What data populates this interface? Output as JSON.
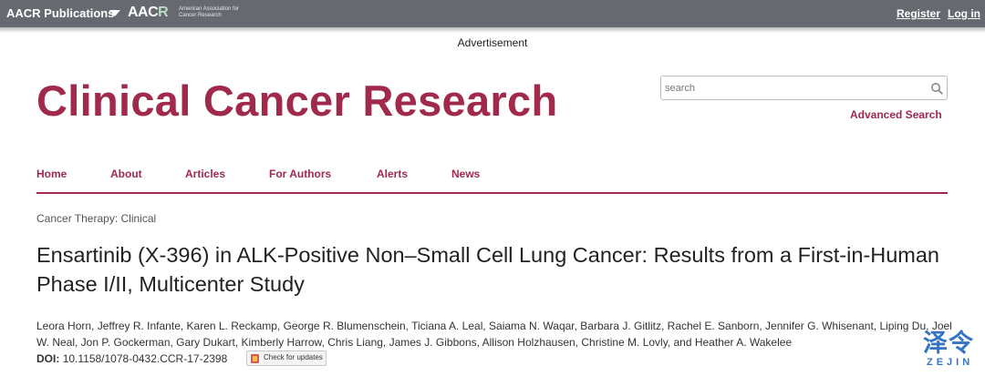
{
  "topbar": {
    "publications_label": "AACR Publications",
    "logo_text_main": "AAC",
    "logo_text_accent": "R",
    "logo_subtitle": "American Association for Cancer Research",
    "register_label": "Register",
    "login_label": "Log in"
  },
  "advertisement_label": "Advertisement",
  "journal_title": "Clinical Cancer Research",
  "search": {
    "placeholder": "search",
    "advanced_label": "Advanced Search"
  },
  "nav": {
    "home": "Home",
    "about": "About",
    "articles": "Articles",
    "for_authors": "For Authors",
    "alerts": "Alerts",
    "news": "News"
  },
  "article": {
    "section": "Cancer Therapy: Clinical",
    "title": "Ensartinib (X-396) in ALK-Positive Non–Small Cell Lung Cancer: Results from a First-in-Human Phase I/II, Multicenter Study",
    "authors": "Leora Horn, Jeffrey R. Infante, Karen L. Reckamp, George R. Blumenschein, Ticiana A. Leal, Saiama N. Waqar, Barbara J. Gitlitz, Rachel E. Sanborn, Jennifer G. Whisenant, Liping Du, Joel W. Neal, Jon P. Gockerman, Gary Dukart, Kimberly Harrow, Chris Liang, James J. Gibbons, Allison Holzhausen, Christine M. Lovly, and Heather A. Wakelee",
    "doi_label": "DOI:",
    "doi_value": "10.1158/1078-0432.CCR-17-2398",
    "check_updates_label": "Check for updates"
  },
  "watermark": {
    "chinese": "泽令",
    "english": "ZEJIN"
  },
  "colors": {
    "brand": "#a12a4c",
    "topbar": "#666a70",
    "watermark": "#3574c4"
  }
}
